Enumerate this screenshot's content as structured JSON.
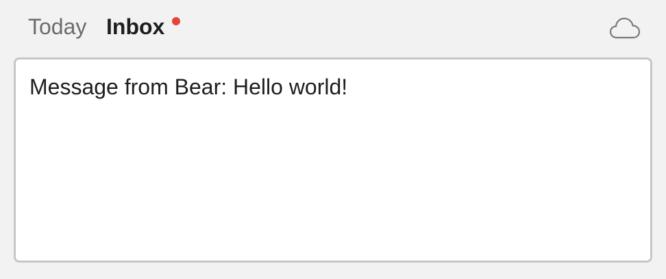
{
  "header": {
    "tabs": [
      {
        "label": "Today",
        "active": false
      },
      {
        "label": "Inbox",
        "active": true,
        "has_unread": true
      }
    ],
    "sync_icon": "cloud-icon"
  },
  "message": {
    "text": "Message from Bear: Hello world!"
  },
  "colors": {
    "background": "#f2f2f2",
    "unread_dot": "#e5433b",
    "box_border": "#c6c6c6",
    "text": "#1e1e1e",
    "inactive_tab": "#6b6b6b",
    "icon": "#7a7a7a"
  }
}
